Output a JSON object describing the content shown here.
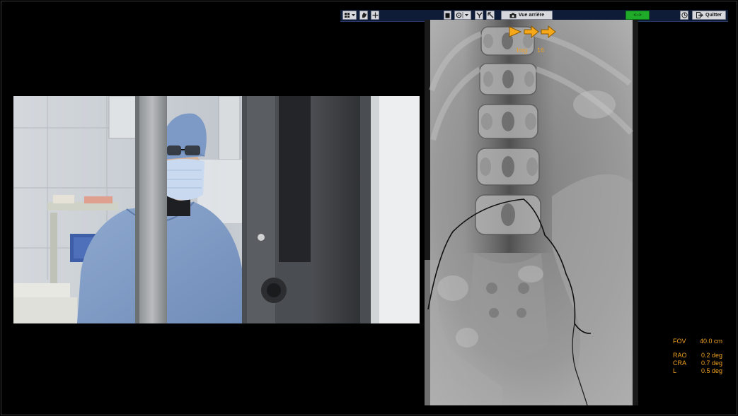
{
  "toolbar": {
    "vue_label": "Vue arrière",
    "quit_label": "Quitter",
    "green_label": "<-->"
  },
  "xray": {
    "img_label": "Img",
    "img_number": "16"
  },
  "info": {
    "fov_label": "FOV",
    "fov_value": "40.0 cm",
    "rao_label": "RAO",
    "rao_value": "0.2 deg",
    "cra_label": "CRA",
    "cra_value": "0.7 deg",
    "l_label": "L",
    "l_value": "0.5 deg"
  },
  "icons": [
    "grid-dropdown-icon",
    "hand-icon",
    "crosshair-icon",
    "square-icon",
    "target-dropdown-icon",
    "pliers-icon",
    "cursor-icon",
    "camera-icon",
    "clock-icon",
    "exit-icon",
    "play-arrow-icon",
    "forward-arrow-icon"
  ],
  "colors": {
    "background": "#000000",
    "toolbar": "#0f1c38",
    "overlay_text": "#f0a020",
    "green_button": "#1faa2a"
  }
}
